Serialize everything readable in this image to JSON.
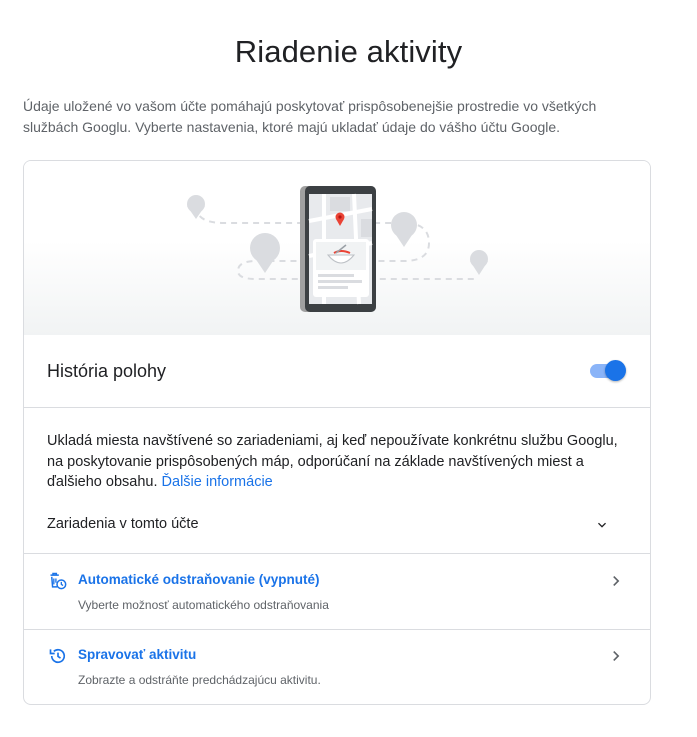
{
  "page": {
    "title": "Riadenie aktivity",
    "intro": "Údaje uložené vo vašom účte pomáhajú poskytovať prispôsobenejšie prostredie vo všetkých službách Googlu. Vyberte nastavenia, ktoré majú ukladať údaje do vášho účtu Google."
  },
  "setting": {
    "title": "História polohy",
    "enabled": true,
    "description": "Ukladá miesta navštívené so zariadeniami, aj keď nepoužívate konkrétnu službu Googlu, na poskytovanie prispôsobených máp, odporúčaní na základe navštívených miest a ďalšieho obsahu.",
    "learn_more": "Ďalšie informácie"
  },
  "devices": {
    "label": "Zariadenia v tomto účte"
  },
  "links": [
    {
      "title": "Automatické odstraňovanie (vypnuté)",
      "subtitle": "Vyberte možnosť automatického odstraňovania",
      "icon": "auto-delete-icon"
    },
    {
      "title": "Spravovať aktivitu",
      "subtitle": "Zobrazte a odstráňte predchádzajúcu aktivitu.",
      "icon": "history-icon"
    }
  ],
  "colors": {
    "accent": "#1a73e8",
    "toggle_track": "#8ab4f8",
    "text_primary": "#202124",
    "text_secondary": "#5f6368",
    "divider": "#dadce0",
    "map_pin": "#ea4335"
  }
}
